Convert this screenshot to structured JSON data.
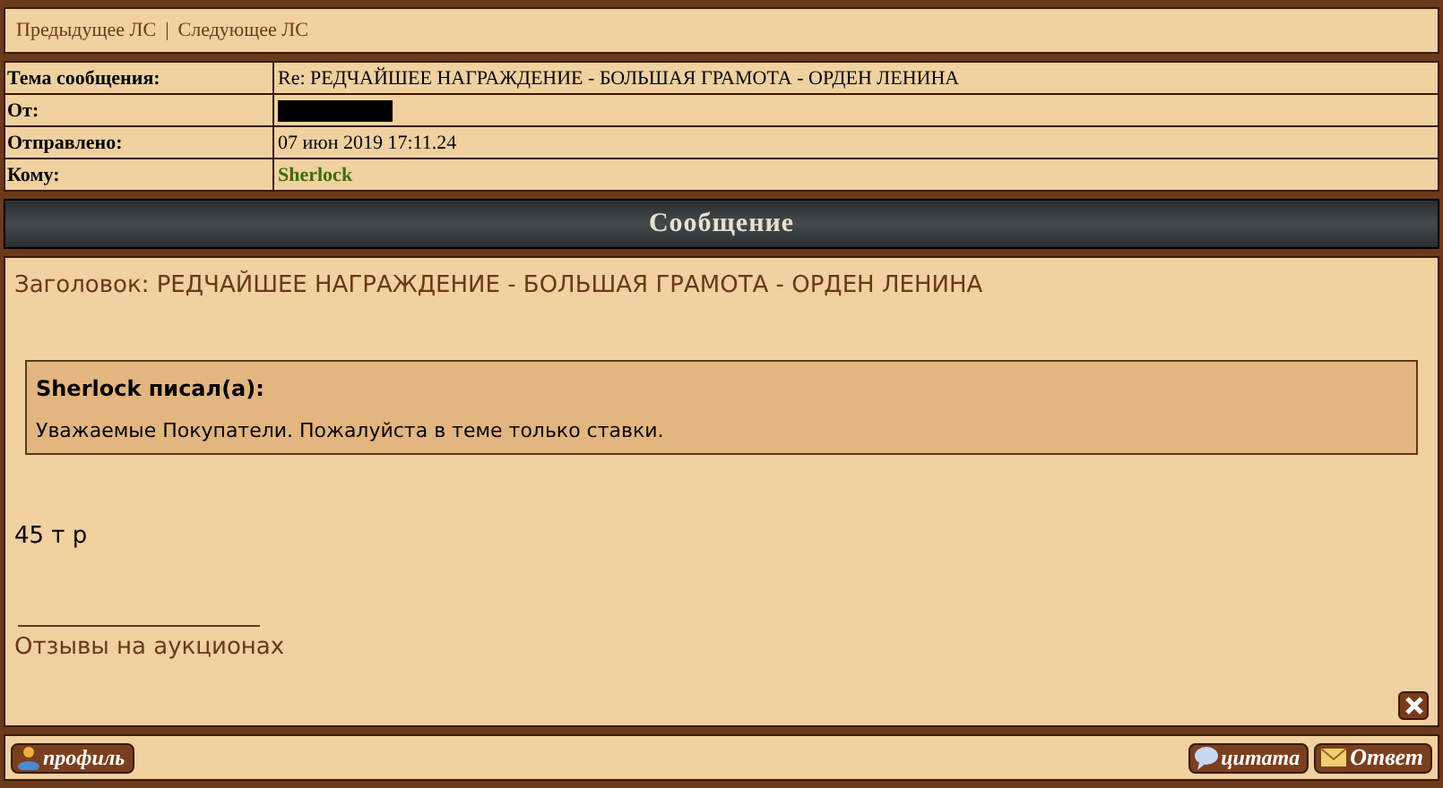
{
  "nav": {
    "prev": "Предыдущее ЛС",
    "separator": "|",
    "next": "Следующее ЛС"
  },
  "header": [
    {
      "label": "Тема сообщения:",
      "kind": "text",
      "value": "Re: РЕДЧАЙШЕЕ НАГРАЖДЕНИЕ - БОЛЬШАЯ ГРАМОТА - ОРДЕН ЛЕНИНА"
    },
    {
      "label": "От:",
      "kind": "redacted"
    },
    {
      "label": "Отправлено:",
      "kind": "text",
      "value": "07 июн 2019 17:11.24"
    },
    {
      "label": "Кому:",
      "kind": "user",
      "value": "Sherlock"
    }
  ],
  "section_title": "Сообщение",
  "message": {
    "subject_label": "Заголовок:",
    "subject": "РЕДЧАЙШЕЕ НАГРАЖДЕНИЕ - БОЛЬШАЯ ГРАМОТА - ОРДЕН ЛЕНИНА",
    "quote": {
      "author": "Sherlock писал(а):",
      "text": "Уважаемые Покупатели. Пожалуйста в теме только ставки."
    },
    "body": "45 т р",
    "signature_link": "Отзывы на аукционах"
  },
  "buttons": {
    "profile": "профиль",
    "quote": "цитата",
    "reply": "Ответ"
  }
}
